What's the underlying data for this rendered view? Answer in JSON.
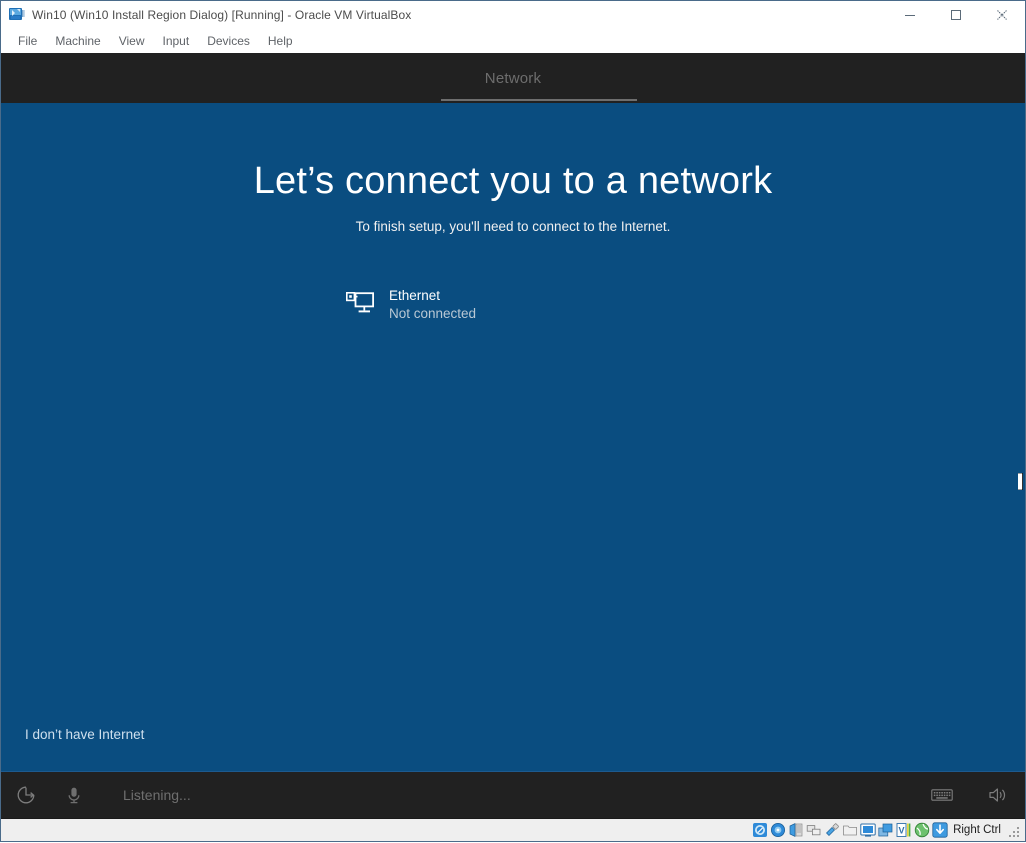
{
  "window": {
    "title": "Win10 (Win10 Install Region Dialog) [Running] - Oracle VM VirtualBox",
    "app_icon": "virtualbox-icon",
    "controls": {
      "minimize": "minimize-icon",
      "maximize": "maximize-icon",
      "close": "close-icon"
    }
  },
  "menubar": {
    "items": [
      {
        "label": "File"
      },
      {
        "label": "Machine"
      },
      {
        "label": "View"
      },
      {
        "label": "Input"
      },
      {
        "label": "Devices"
      },
      {
        "label": "Help"
      }
    ]
  },
  "oobe": {
    "header_title": "Network",
    "heading": "Let’s connect you to a network",
    "subheading": "To finish setup, you'll need to connect to the Internet.",
    "networks": [
      {
        "icon": "ethernet-icon",
        "name": "Ethernet",
        "status": "Not connected"
      }
    ],
    "skip_link": "I don’t have Internet",
    "footer": {
      "ease_of_access_icon": "ease-of-access-icon",
      "microphone_icon": "microphone-icon",
      "listening_text": "Listening...",
      "keyboard_icon": "keyboard-icon",
      "volume_icon": "volume-icon"
    },
    "colors": {
      "background": "#0a4d80",
      "header_bar": "#212121",
      "heading_text": "#ffffff",
      "status_text": "#b9c8d4",
      "link_text": "#cfe0ee"
    }
  },
  "statusbar": {
    "icons": [
      {
        "name": "hard-disk-icon"
      },
      {
        "name": "optical-disk-icon"
      },
      {
        "name": "floppy-disk-icon"
      },
      {
        "name": "network-adapter-icon"
      },
      {
        "name": "usb-icon"
      },
      {
        "name": "shared-folders-icon"
      },
      {
        "name": "display-icon"
      },
      {
        "name": "video-capture-icon"
      },
      {
        "name": "vm-features-icon"
      },
      {
        "name": "mouse-integration-icon"
      },
      {
        "name": "host-key-icon"
      }
    ],
    "host_key_label": "Right Ctrl"
  }
}
